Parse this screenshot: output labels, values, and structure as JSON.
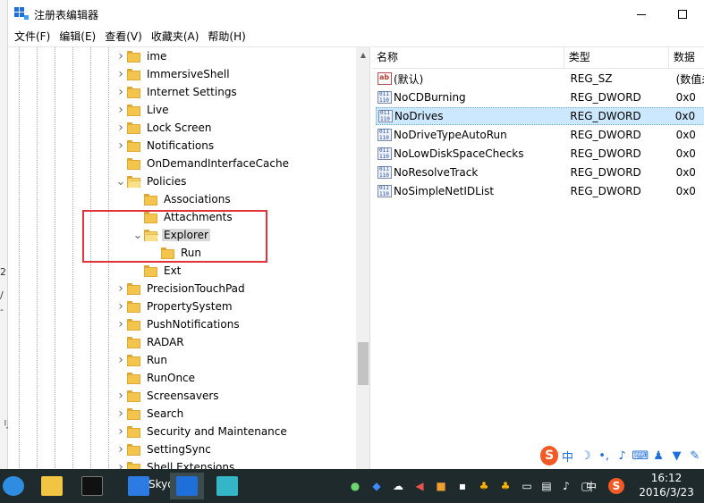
{
  "window": {
    "title": "注册表编辑器"
  },
  "menu": [
    "文件(F)",
    "编辑(E)",
    "查看(V)",
    "收藏夹(A)",
    "帮助(H)"
  ],
  "tree": [
    {
      "label": "ime",
      "expander": "collapsed",
      "level": 1
    },
    {
      "label": "ImmersiveShell",
      "expander": "collapsed",
      "level": 1
    },
    {
      "label": "Internet Settings",
      "expander": "collapsed",
      "level": 1
    },
    {
      "label": "Live",
      "expander": "collapsed",
      "level": 1
    },
    {
      "label": "Lock Screen",
      "expander": "collapsed",
      "level": 1
    },
    {
      "label": "Notifications",
      "expander": "collapsed",
      "level": 1
    },
    {
      "label": "OnDemandInterfaceCache",
      "expander": "none",
      "level": 1
    },
    {
      "label": "Policies",
      "expander": "expanded",
      "level": 1
    },
    {
      "label": "Associations",
      "expander": "none",
      "level": 2
    },
    {
      "label": "Attachments",
      "expander": "none",
      "level": 2
    },
    {
      "label": "Explorer",
      "expander": "expanded",
      "level": 2,
      "selected": true
    },
    {
      "label": "Run",
      "expander": "none",
      "level": 3
    },
    {
      "label": "Ext",
      "expander": "none",
      "level": 2
    },
    {
      "label": "PrecisionTouchPad",
      "expander": "collapsed",
      "level": 1
    },
    {
      "label": "PropertySystem",
      "expander": "collapsed",
      "level": 1
    },
    {
      "label": "PushNotifications",
      "expander": "collapsed",
      "level": 1
    },
    {
      "label": "RADAR",
      "expander": "none",
      "level": 1
    },
    {
      "label": "Run",
      "expander": "collapsed",
      "level": 1
    },
    {
      "label": "RunOnce",
      "expander": "none",
      "level": 1
    },
    {
      "label": "Screensavers",
      "expander": "collapsed",
      "level": 1
    },
    {
      "label": "Search",
      "expander": "collapsed",
      "level": 1
    },
    {
      "label": "Security and Maintenance",
      "expander": "collapsed",
      "level": 1
    },
    {
      "label": "SettingSync",
      "expander": "collapsed",
      "level": 1
    },
    {
      "label": "Shell Extensions",
      "expander": "collapsed",
      "level": 1
    }
  ],
  "list": {
    "columns": [
      "名称",
      "类型",
      "数据"
    ],
    "rows": [
      {
        "name": "(默认)",
        "type": "REG_SZ",
        "data": "(数值未设置)",
        "icon": "string-value-icon"
      },
      {
        "name": "NoCDBurning",
        "type": "REG_DWORD",
        "data": "0x0",
        "icon": "binary-value-icon"
      },
      {
        "name": "NoDrives",
        "type": "REG_DWORD",
        "data": "0x0",
        "icon": "binary-value-icon",
        "selected": true
      },
      {
        "name": "NoDriveTypeAutoRun",
        "type": "REG_DWORD",
        "data": "0x0",
        "icon": "binary-value-icon"
      },
      {
        "name": "NoLowDiskSpaceChecks",
        "type": "REG_DWORD",
        "data": "0x0",
        "icon": "binary-value-icon"
      },
      {
        "name": "NoResolveTrack",
        "type": "REG_DWORD",
        "data": "0x0",
        "icon": "binary-value-icon"
      },
      {
        "name": "NoSimpleNetIDList",
        "type": "REG_DWORD",
        "data": "0x0",
        "icon": "binary-value-icon"
      }
    ]
  },
  "background_fragments": [
    "2",
    "/",
    "-",
    "刂"
  ],
  "taskbar": {
    "partial_label": "Skyd",
    "tray_lang": "中",
    "clock_time": "16:12",
    "clock_date": "2016/3/23"
  },
  "ime_bar": {
    "logo": "S",
    "mode": "中"
  },
  "colors": {
    "selection_row": "#cce8ff",
    "highlight_box": "#e0333a",
    "taskbar_bg": "#1f2a2c",
    "folder": "#f3c54c",
    "sogou_orange": "#f15a24"
  }
}
